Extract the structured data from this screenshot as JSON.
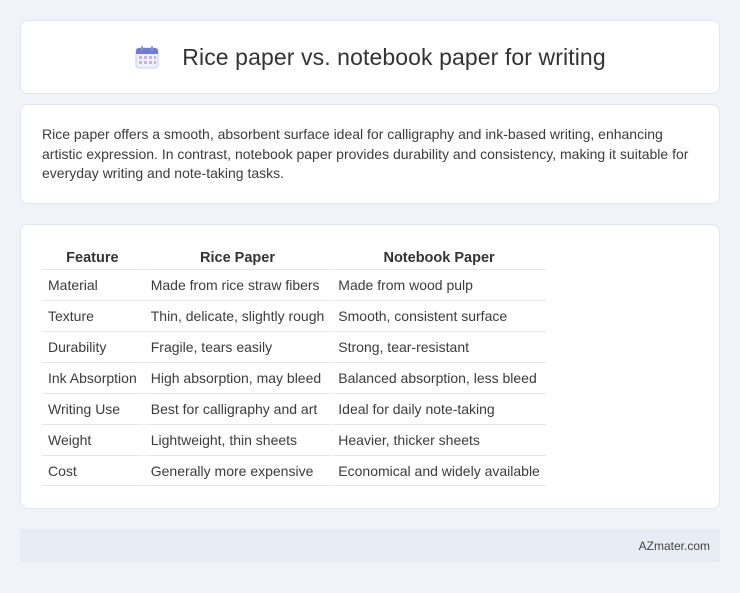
{
  "header": {
    "title": "Rice paper vs. notebook paper for writing",
    "icon": "calendar-icon"
  },
  "summary": {
    "text": "Rice paper offers a smooth, absorbent surface ideal for calligraphy and ink-based writing, enhancing artistic expression. In contrast, notebook paper provides durability and consistency, making it suitable for everyday writing and note-taking tasks."
  },
  "table": {
    "headers": [
      "Feature",
      "Rice Paper",
      "Notebook Paper"
    ],
    "rows": [
      [
        "Material",
        "Made from rice straw fibers",
        "Made from wood pulp"
      ],
      [
        "Texture",
        "Thin, delicate, slightly rough",
        "Smooth, consistent surface"
      ],
      [
        "Durability",
        "Fragile, tears easily",
        "Strong, tear-resistant"
      ],
      [
        "Ink Absorption",
        "High absorption, may bleed",
        "Balanced absorption, less bleed"
      ],
      [
        "Writing Use",
        "Best for calligraphy and art",
        "Ideal for daily note-taking"
      ],
      [
        "Weight",
        "Lightweight, thin sheets",
        "Heavier, thicker sheets"
      ],
      [
        "Cost",
        "Generally more expensive",
        "Economical and widely available"
      ]
    ]
  },
  "footer": {
    "text": "AZmater.com"
  },
  "colors": {
    "background": "#f0f3f8",
    "card": "#ffffff",
    "footer": "#e7ecf5",
    "icon_accent": "#6b7bd8"
  }
}
